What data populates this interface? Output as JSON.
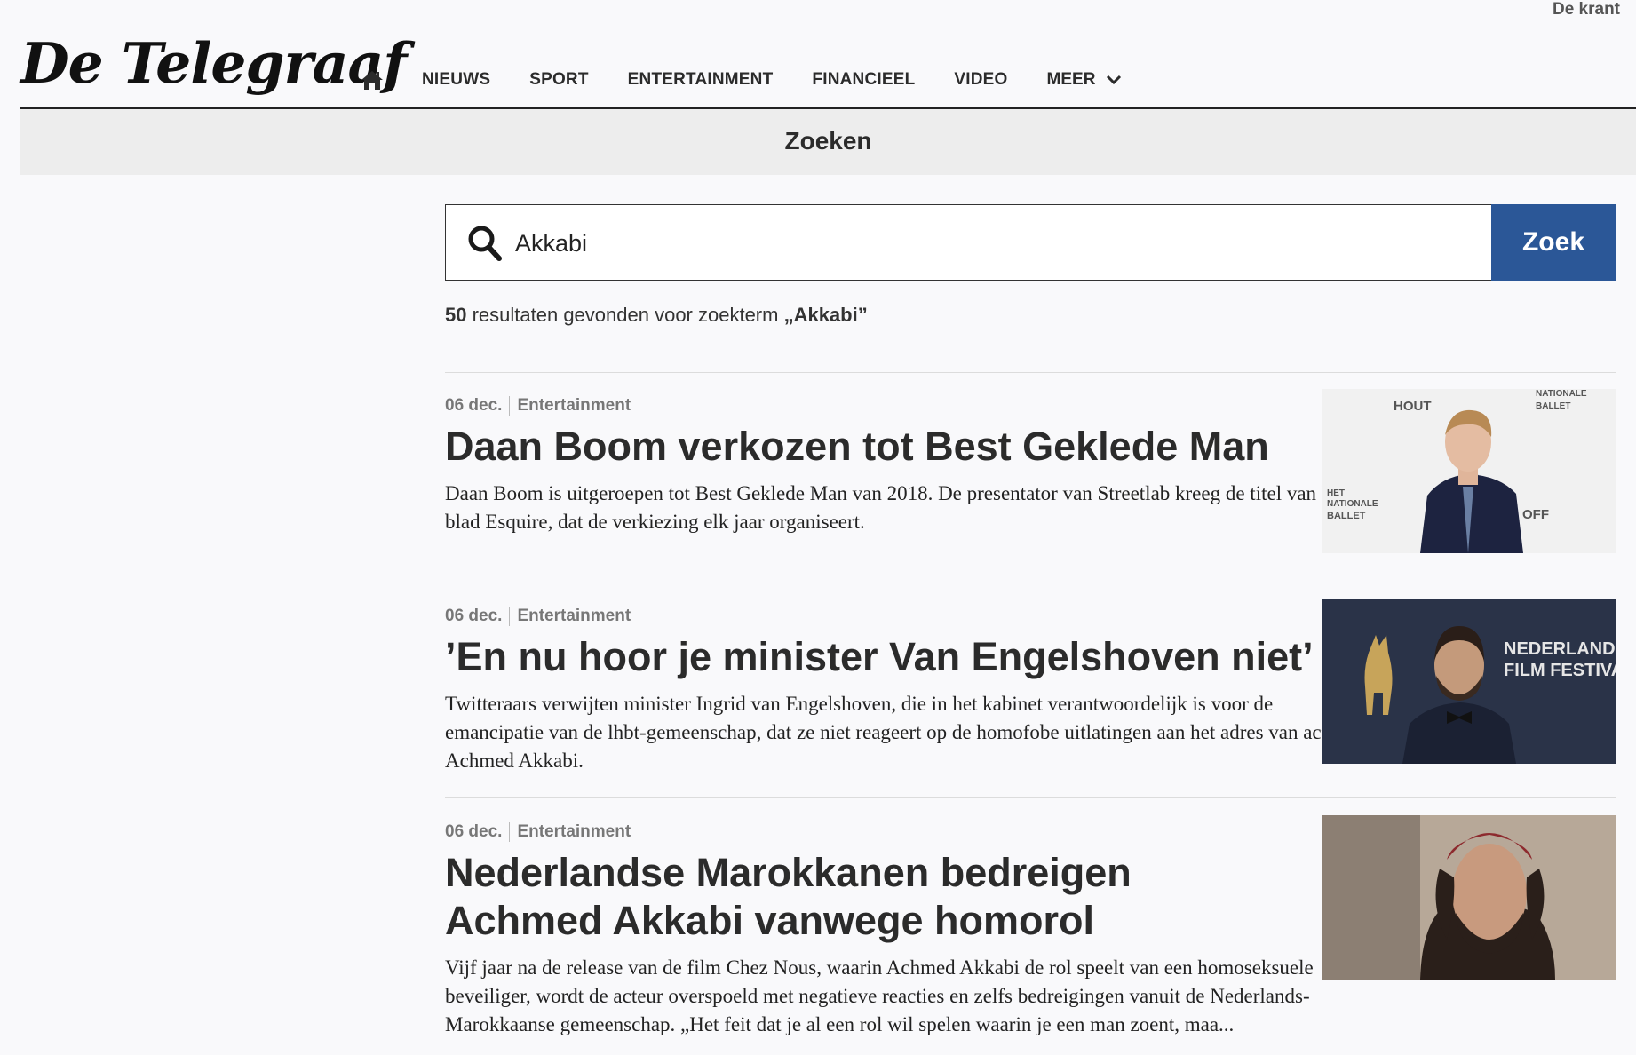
{
  "topbar": {
    "link": "De krant"
  },
  "brand": {
    "logo_text": "De Telegraaf"
  },
  "nav": {
    "home_icon": "home-icon",
    "items": [
      "NIEUWS",
      "SPORT",
      "ENTERTAINMENT",
      "FINANCIEEL",
      "VIDEO"
    ],
    "more_label": "MEER"
  },
  "page": {
    "title": "Zoeken"
  },
  "search": {
    "value": "Akkabi",
    "button_label": "Zoek"
  },
  "results": {
    "count": "50",
    "text": " resultaten gevonden voor zoekterm ",
    "term": "„Akkabi”"
  },
  "articles": [
    {
      "date": "06 dec.",
      "category": "Entertainment",
      "title": "Daan Boom verkozen tot Best Geklede Man",
      "summary": "Daan Boom is uitgeroepen tot Best Geklede Man van 2018. De presentator van Streetlab kreeg de titel van het blad Esquire, dat de verkiezing elk jaar organiseert."
    },
    {
      "date": "06 dec.",
      "category": "Entertainment",
      "title": "’En nu hoor je minister Van Engelshoven niet’",
      "summary": "Twitteraars verwijten minister Ingrid van Engelshoven, die in het kabinet verantwoordelijk is voor de emancipatie van de lhbt-gemeenschap, dat ze niet reageert op de homofobe uitlatingen aan het adres van acteur Achmed Akkabi."
    },
    {
      "date": "06 dec.",
      "category": "Entertainment",
      "title": "Nederlandse Marokkanen bedreigen Achmed Akkabi vanwege homorol",
      "summary": "Vijf jaar na de release van de film Chez Nous, waarin Achmed Akkabi de rol speelt van een homoseksuele beveiliger, wordt de acteur overspoeld met negatieve reacties en zelfs bedreigingen vanuit de Nederlands-Marokkaanse gemeenschap. „Het feit dat je al een rol wil spelen waarin je een man zoent, maa..."
    }
  ],
  "photo_texts": {
    "a1_wall_1": "HOUT",
    "a1_wall_2": "NATIONALE",
    "a1_wall_3": "BALLET",
    "a1_wall_4": "HET",
    "a1_wall_5": "NATIONALE",
    "a1_wall_6": "BALLET",
    "a1_wall_7": "OFF",
    "a2_banner_1": "NEDERLAND",
    "a2_banner_2": "FILM FESTIVA"
  },
  "colors": {
    "accent": "#2b5797",
    "subbar": "#ededed",
    "text": "#2b2b2b"
  }
}
